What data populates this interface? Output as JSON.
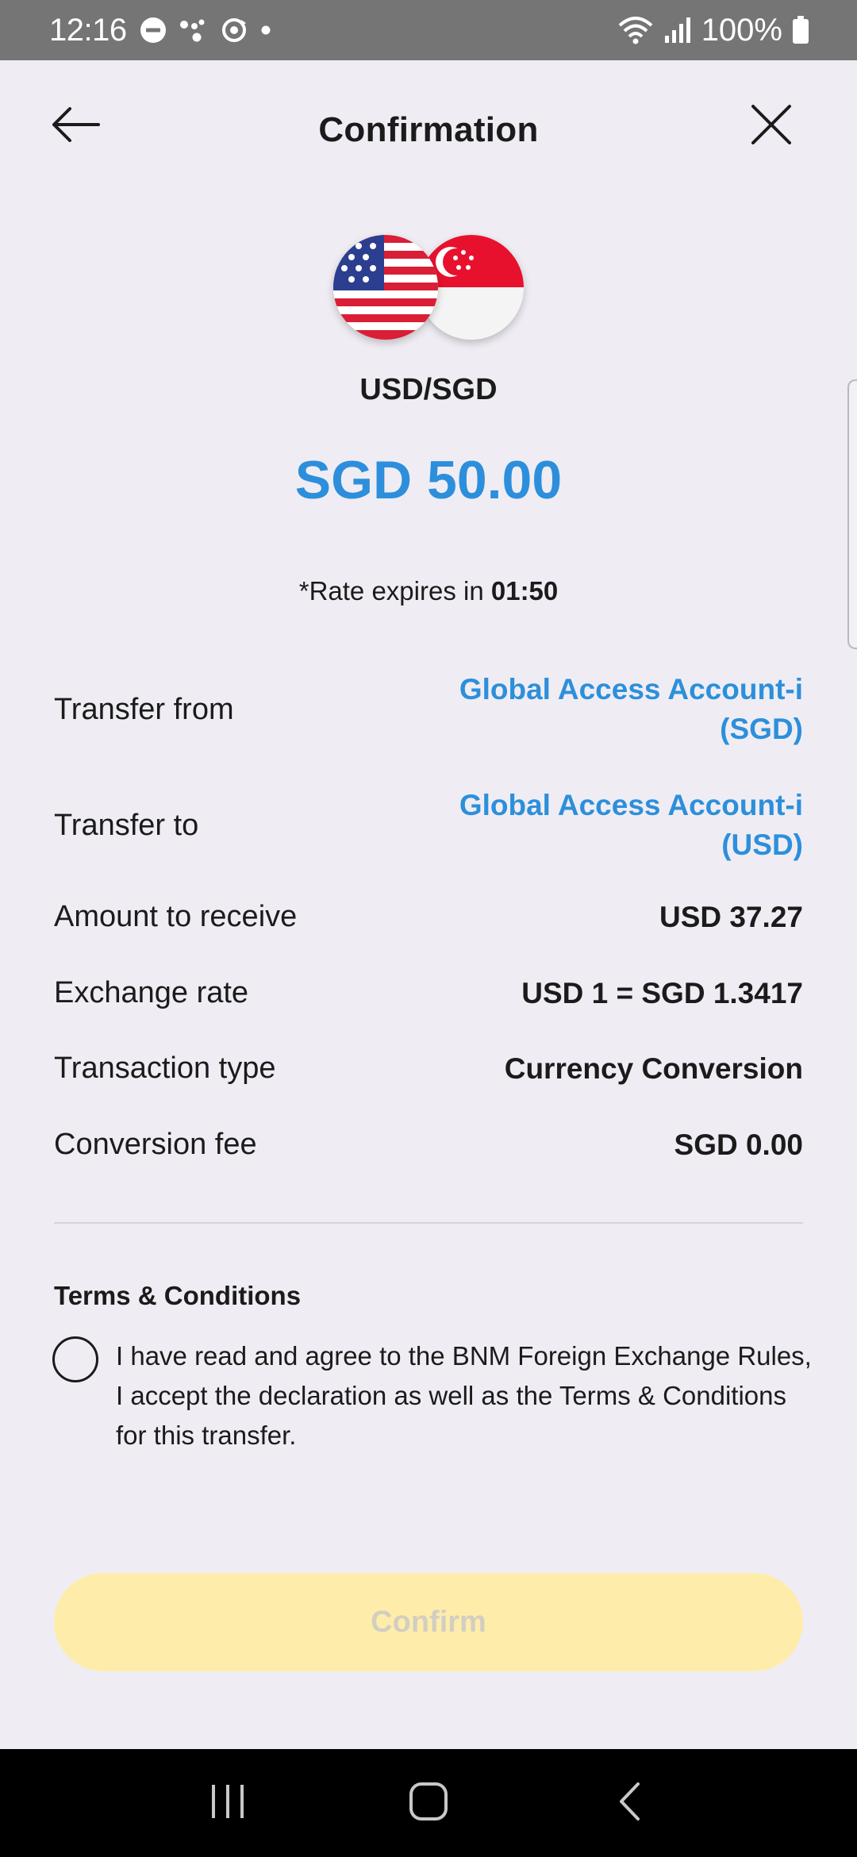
{
  "status_bar": {
    "time": "12:16",
    "battery": "100%",
    "icons": [
      "dnd-icon",
      "assistant-icon",
      "sync-icon",
      "dot-icon",
      "wifi-icon",
      "signal-icon",
      "battery-icon"
    ]
  },
  "header": {
    "title": "Confirmation",
    "back_icon": "arrow-left-icon",
    "close_icon": "close-icon"
  },
  "currency": {
    "pair": "USD/SGD",
    "amount": "SGD 50.00",
    "expiry_prefix": "*Rate expires in ",
    "expiry_time": "01:50",
    "flags": [
      "us-flag-icon",
      "sg-flag-icon"
    ]
  },
  "details": {
    "transfer_from_label": "Transfer from",
    "transfer_from_line1": "Global Access Account-i",
    "transfer_from_line2": "(SGD)",
    "transfer_to_label": "Transfer to",
    "transfer_to_line1": "Global Access Account-i",
    "transfer_to_line2": "(USD)",
    "amount_to_receive_label": "Amount to receive",
    "amount_to_receive_value": "USD 37.27",
    "exchange_rate_label": "Exchange rate",
    "exchange_rate_value": "USD 1 = SGD 1.3417",
    "transaction_type_label": "Transaction type",
    "transaction_type_value": "Currency Conversion",
    "conversion_fee_label": "Conversion fee",
    "conversion_fee_value": "SGD 0.00"
  },
  "terms": {
    "heading": "Terms & Conditions",
    "text": "I have read and agree to the BNM Foreign Exchange Rules, I accept the declaration as well as the Terms & Conditions for this transfer.",
    "checked": false
  },
  "confirm_button": {
    "label": "Confirm",
    "enabled": false
  },
  "colors": {
    "accent_blue": "#2D8FDB",
    "button_disabled_bg": "#FEEDAA",
    "background": "#EFEDF3"
  }
}
